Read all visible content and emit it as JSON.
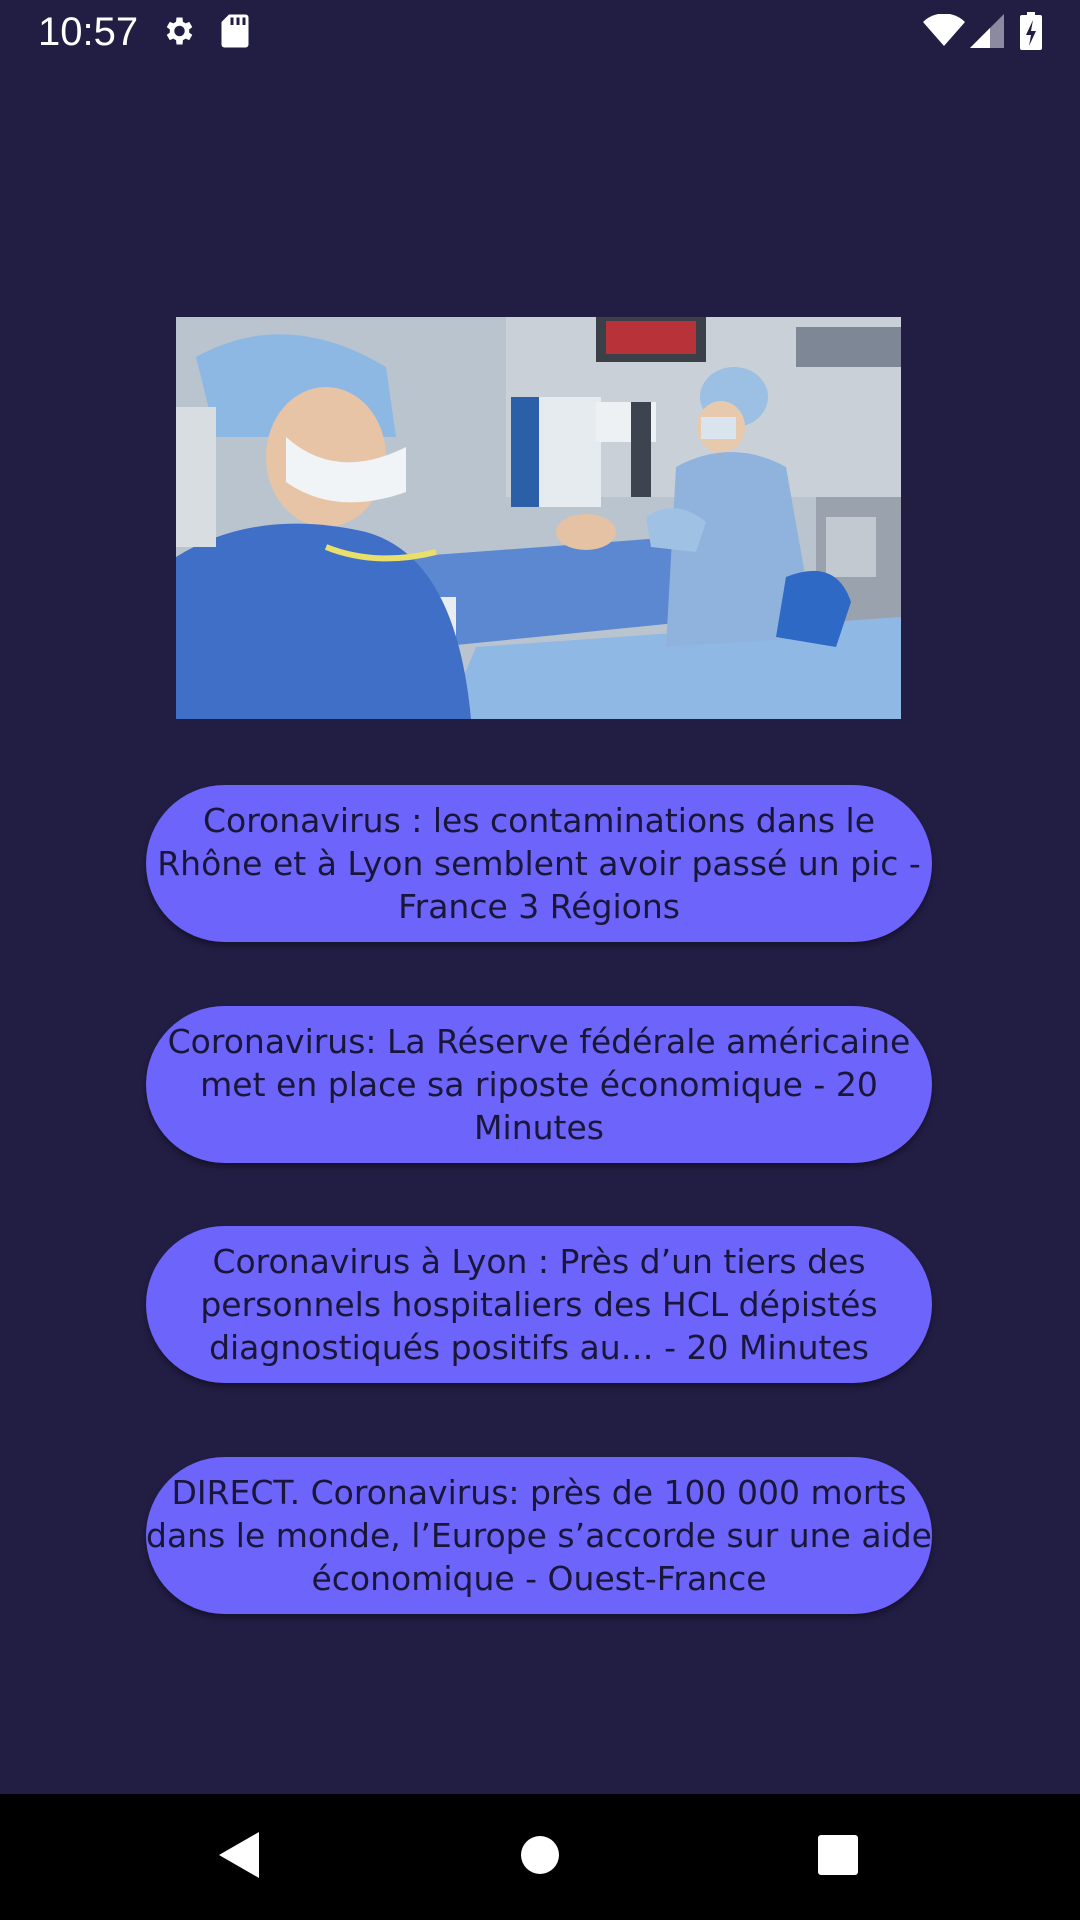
{
  "status_bar": {
    "time": "10:57",
    "icons": [
      "settings-icon",
      "sd-card-icon",
      "wifi-icon",
      "cell-signal-icon",
      "battery-charging-icon"
    ]
  },
  "hero_image": {
    "description_icon": "photo"
  },
  "headlines": [
    {
      "text": "Coronavirus : les contaminations dans le Rhône et à Lyon semblent avoir passé un pic - France 3 Régions"
    },
    {
      "text": "Coronavirus: La Réserve fédérale américaine met en place sa riposte économique - 20 Minutes"
    },
    {
      "text": "Coronavirus à Lyon : Près d’un tiers des personnels hospitaliers des HCL dépistés diagnostiqués positifs au… - 20 Minutes"
    },
    {
      "text": "DIRECT. Coronavirus: près de 100 000 morts dans le monde, l’Europe s’accorde sur une aide économique - Ouest-France"
    }
  ],
  "nav_bar": {
    "buttons": [
      "back-icon",
      "home-icon",
      "recents-icon"
    ]
  },
  "colors": {
    "background": "#221d43",
    "button": "#6d64fc",
    "button_text": "#1a1638",
    "nav_bar": "#000000"
  }
}
